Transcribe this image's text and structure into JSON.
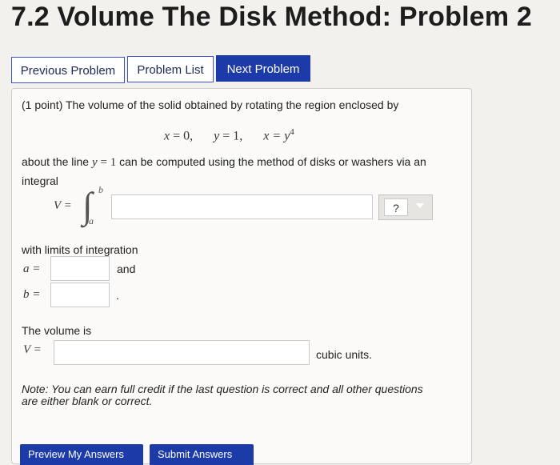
{
  "page": {
    "title": "7.2 Volume The Disk Method: Problem 2"
  },
  "nav": {
    "previous_label": "Previous Problem",
    "list_label": "Problem List",
    "next_label": "Next Problem"
  },
  "problem": {
    "intro": "(1 point) The volume of the solid obtained by rotating the region enclosed by",
    "eq1_lhs": "x",
    "eq1_rhs": "= 0,",
    "eq2_lhs": "y",
    "eq2_rhs": "= 1,",
    "eq3_lhs": "x",
    "eq3_mid": "= y",
    "eq3_exp": "4",
    "about_pre": "about the line",
    "about_var": "y",
    "about_rhs": "= 1",
    "about_post": "can be computed using the method of disks or washers via an",
    "about_line2": "integral",
    "integral_lhs": "V =",
    "upper_limit": "b",
    "lower_limit": "a",
    "integrand_value": "",
    "unit_value": "?",
    "limits_intro": "with limits of integration",
    "a_label": "a =",
    "a_value": "",
    "and_word": "and",
    "b_label": "b =",
    "b_value": "",
    "b_period": ".",
    "volume_intro": "The volume is",
    "v_label": "V =",
    "volume_value": "",
    "cubic_units": "cubic units.",
    "note_line1": "Note: You can earn full credit if the last question is correct and all other questions",
    "note_line2": "are either blank or correct."
  },
  "actions": {
    "preview_label": "Preview My Answers",
    "submit_label": "Submit Answers"
  },
  "colors": {
    "accent": "#1c3aa8",
    "background": "#f3f1ee",
    "panel": "#fbfaf8"
  }
}
